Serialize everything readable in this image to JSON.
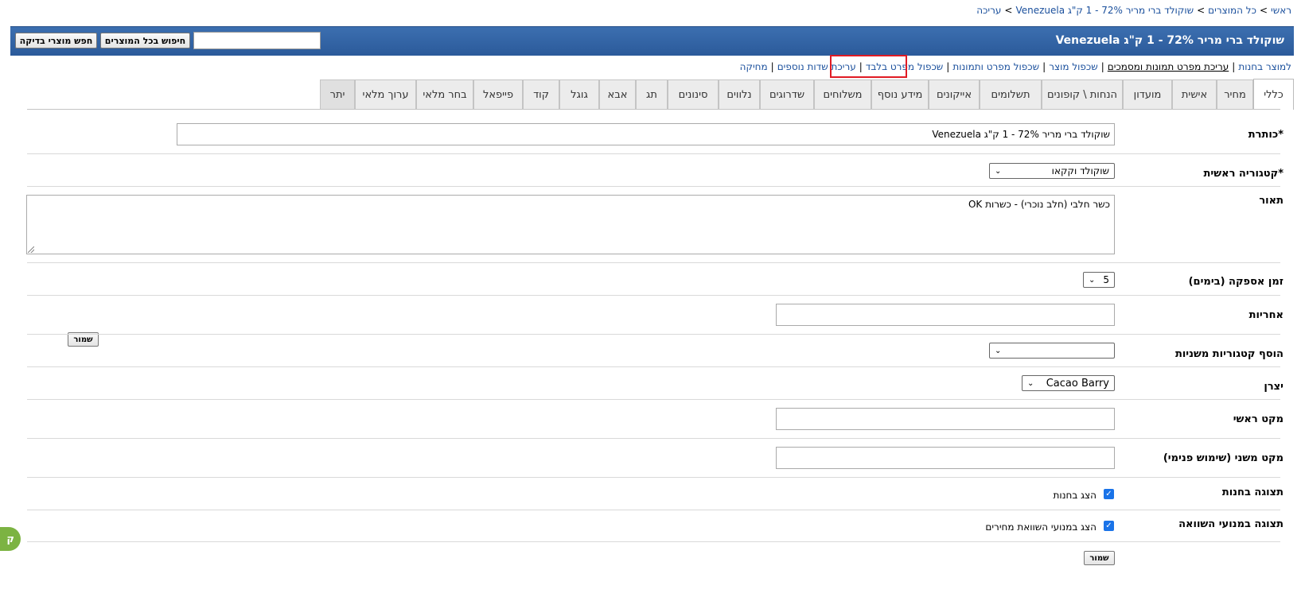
{
  "breadcrumb": {
    "home": "ראשי",
    "all_products": "כל המוצרים",
    "product": "שוקולד ברי מריר 72% - 1 ק\"ג Venezuela",
    "edit": "עריכה"
  },
  "header": {
    "title": "שוקולד ברי מריר 72% - 1 ק\"ג Venezuela",
    "search_all_label": "חיפוש בכל המוצרים",
    "search_test_label": "חפש מוצרי בדיקה",
    "search_value": ""
  },
  "links": {
    "to_product_in_store": "למוצר בחנות",
    "edit_item_images": "עריכת מפרט תמונות ומסמכים",
    "duplicate_product": "שכפול מוצר",
    "duplicate_item_images": "שכפול מפרט ותמונות",
    "duplicate_item_only": "שכפול מפרט בלבד",
    "edit_extra_fields": "עריכת שדות נוספים",
    "delete": "מחיקה"
  },
  "tabs": [
    "כללי",
    "מחיר",
    "אישית",
    "מועדון",
    "הנחות \\ קופונים",
    "תשלומים",
    "אייקונים",
    "מידע נוסף",
    "משלוחים",
    "שדרוגים",
    "נלווים",
    "סינונים",
    "תג",
    "אבא",
    "גוגל",
    "קוד",
    "פייפאל",
    "בחר מלאי",
    "ערוך מלאי",
    "יתר"
  ],
  "form": {
    "title_label": "*כותרת",
    "title_value": "שוקולד ברי מריר 72% - 1 ק\"ג Venezuela",
    "main_category_label": "*קטגוריה ראשית",
    "main_category_value": "שוקולד וקקאו",
    "description_label": "תאור",
    "description_value": "כשר חלבי (חלב נוכרי) - כשרות OK",
    "delivery_time_label": "זמן אספקה (בימים)",
    "delivery_time_value": "5",
    "warranty_label": "אחריות",
    "warranty_value": "",
    "save_side_label": "שמור",
    "secondary_categories_label": "הוסף קטגוריות משניות",
    "secondary_categories_value": "",
    "manufacturer_label": "יצרן",
    "manufacturer_value": "Cacao Barry",
    "main_sku_label": "מקט ראשי",
    "main_sku_value": "",
    "secondary_sku_label": "מקט משני (שימוש פנימי)",
    "secondary_sku_value": "",
    "store_display_label": "תצוגה בחנות",
    "store_display_check": "הצג בחנות",
    "compare_display_label": "תצוגה במנועי השוואה",
    "compare_display_check": "הצג במנועי השוואת מחירים",
    "save_bottom_label": "שמור"
  },
  "side_badge": "ק",
  "colors": {
    "header_bg": "#2f5fa3",
    "link": "#1a4f9c",
    "highlight": "#e01b24",
    "badge": "#7cb342",
    "checkbox": "#1a73e8"
  }
}
